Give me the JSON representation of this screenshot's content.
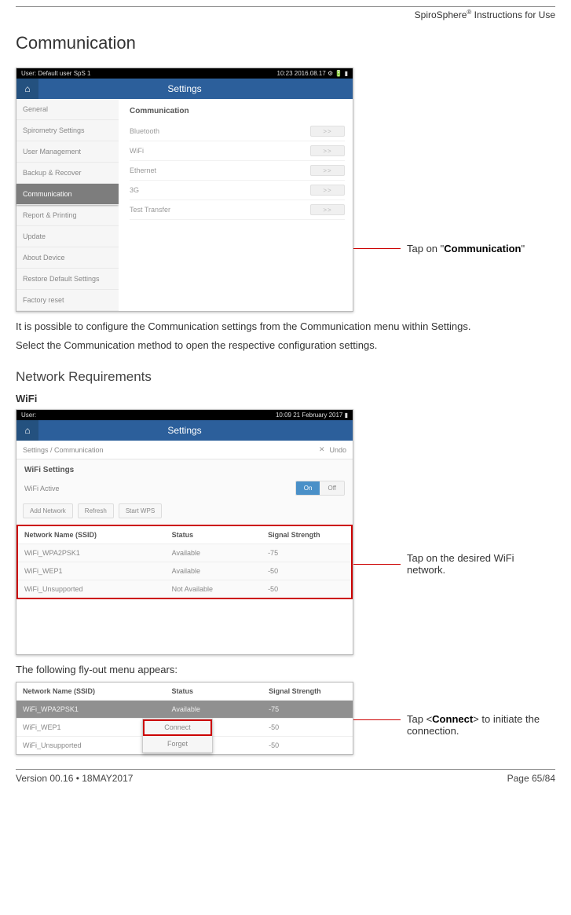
{
  "doc": {
    "header_product": "SpiroSphere",
    "header_suffix": " Instructions for Use",
    "footer_version": "Version 00.16 • 18MAY2017",
    "footer_page": "Page 65/84"
  },
  "headings": {
    "h1": "Communication",
    "h2": "Network Requirements",
    "h3_wifi": "WiFi"
  },
  "paragraphs": {
    "p1": "It is possible to configure the Communication settings from the Communication menu within Settings.",
    "p2": "Select the Communication method to open the respective configuration settings.",
    "p3": "The following fly-out menu appears:"
  },
  "annotations": {
    "a1_prefix": "Tap on \"",
    "a1_bold": "Communication",
    "a1_suffix": "\"",
    "a2": "Tap on the desired WiFi network.",
    "a3_prefix": "Tap <",
    "a3_bold": "Connect",
    "a3_suffix": "> to initiate the connection."
  },
  "screenshot1": {
    "top_left": "User: Default user SpS 1",
    "top_right": "10:23 2016.08.17  ⚙ 🔋 ▮",
    "title": "Settings",
    "sidebar": [
      "General",
      "Spirometry Settings",
      "User Management",
      "Backup & Recover",
      "Communication",
      "Report & Printing",
      "Update",
      "About Device",
      "Restore Default Settings",
      "Factory reset"
    ],
    "main_heading": "Communication",
    "rows": [
      {
        "label": "Bluetooth",
        "chev": ">>"
      },
      {
        "label": "WiFi",
        "chev": ">>"
      },
      {
        "label": "Ethernet",
        "chev": ">>"
      },
      {
        "label": "3G",
        "chev": ">>"
      },
      {
        "label": "Test Transfer",
        "chev": ">>"
      }
    ]
  },
  "screenshot2": {
    "top_left": "User:",
    "top_right": "10:09 21 February 2017  ▮",
    "title": "Settings",
    "breadcrumb": "Settings / Communication",
    "undo_x": "✕",
    "undo_label": "Undo",
    "section_heading": "WiFi Settings",
    "active_label": "WiFi Active",
    "toggle_on": "On",
    "toggle_off": "Off",
    "buttons": [
      "Add Network",
      "Refresh",
      "Start WPS"
    ],
    "table_head": {
      "c1": "Network Name (SSID)",
      "c2": "Status",
      "c3": "Signal Strength"
    },
    "rows": [
      {
        "c1": "WiFi_WPA2PSK1",
        "c2": "Available",
        "c3": "-75"
      },
      {
        "c1": "WiFi_WEP1",
        "c2": "Available",
        "c3": "-50"
      },
      {
        "c1": "WiFi_Unsupported",
        "c2": "Not Available",
        "c3": "-50"
      }
    ]
  },
  "screenshot3": {
    "table_head": {
      "c1": "Network Name (SSID)",
      "c2": "Status",
      "c3": "Signal Strength"
    },
    "rows": [
      {
        "c1": "WiFi_WPA2PSK1",
        "c2": "Available",
        "c3": "-75"
      },
      {
        "c1": "WiFi_WEP1",
        "c2": "",
        "c3": "-50"
      },
      {
        "c1": "WiFi_Unsupported",
        "c2": "",
        "c3": "-50"
      }
    ],
    "menu": {
      "opt1": "Connect",
      "opt2": "Forget"
    }
  }
}
